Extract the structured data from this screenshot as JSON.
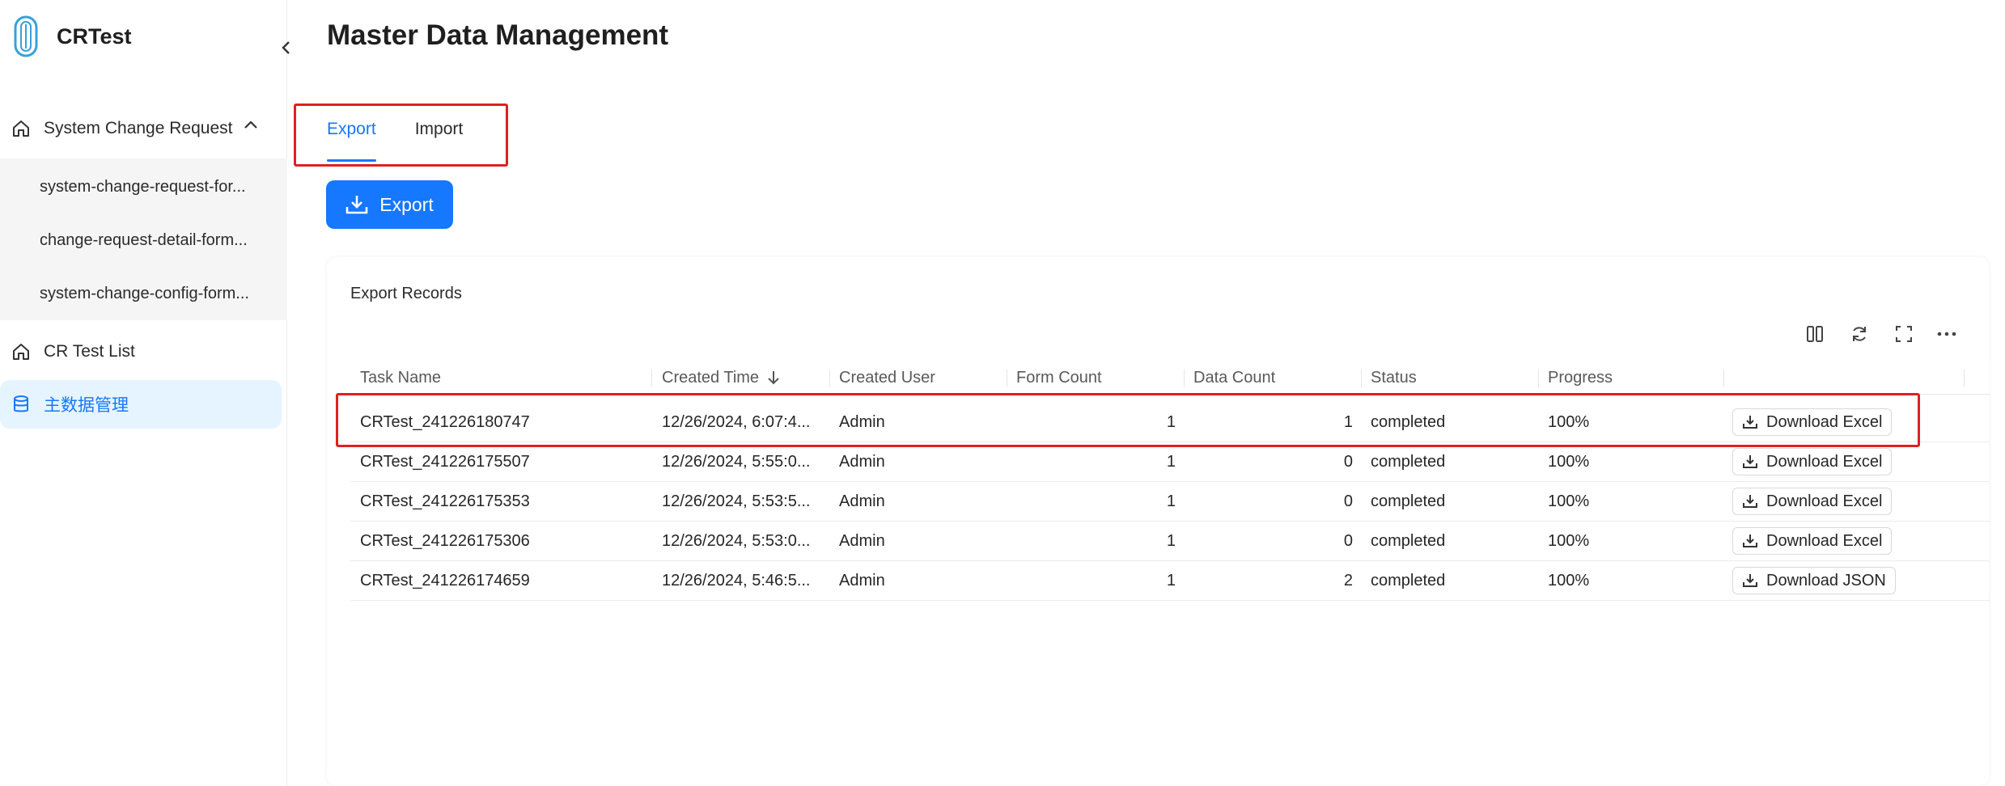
{
  "app": {
    "name": "CRTest"
  },
  "sidebar": {
    "groups": [
      {
        "label": "System Change Request",
        "icon": "home-icon",
        "expanded": true,
        "children": [
          {
            "label": "system-change-request-for..."
          },
          {
            "label": "change-request-detail-form..."
          },
          {
            "label": "system-change-config-form..."
          }
        ]
      }
    ],
    "items": [
      {
        "label": "CR Test List",
        "icon": "home-icon"
      },
      {
        "label": "主数据管理",
        "icon": "database-icon",
        "active": true
      }
    ]
  },
  "page": {
    "title": "Master Data Management"
  },
  "tabs": [
    {
      "label": "Export",
      "active": true
    },
    {
      "label": "Import",
      "active": false
    }
  ],
  "export_button": {
    "label": "Export"
  },
  "records": {
    "title": "Export Records",
    "columns": [
      "Task Name",
      "Created Time",
      "Created User",
      "Form Count",
      "Data Count",
      "Status",
      "Progress"
    ],
    "rows": [
      {
        "task": "CRTest_241226180747",
        "time": "12/26/2024, 6:07:4...",
        "user": "Admin",
        "forms": "1",
        "data": "1",
        "status": "completed",
        "progress": "100%",
        "action": "Download Excel"
      },
      {
        "task": "CRTest_241226175507",
        "time": "12/26/2024, 5:55:0...",
        "user": "Admin",
        "forms": "1",
        "data": "0",
        "status": "completed",
        "progress": "100%",
        "action": "Download Excel"
      },
      {
        "task": "CRTest_241226175353",
        "time": "12/26/2024, 5:53:5...",
        "user": "Admin",
        "forms": "1",
        "data": "0",
        "status": "completed",
        "progress": "100%",
        "action": "Download Excel"
      },
      {
        "task": "CRTest_241226175306",
        "time": "12/26/2024, 5:53:0...",
        "user": "Admin",
        "forms": "1",
        "data": "0",
        "status": "completed",
        "progress": "100%",
        "action": "Download Excel"
      },
      {
        "task": "CRTest_241226174659",
        "time": "12/26/2024, 5:46:5...",
        "user": "Admin",
        "forms": "1",
        "data": "2",
        "status": "completed",
        "progress": "100%",
        "action": "Download JSON"
      }
    ]
  },
  "colors": {
    "accent": "#1677ff",
    "highlight": "#e02020",
    "active_bg": "#e6f4ff"
  }
}
